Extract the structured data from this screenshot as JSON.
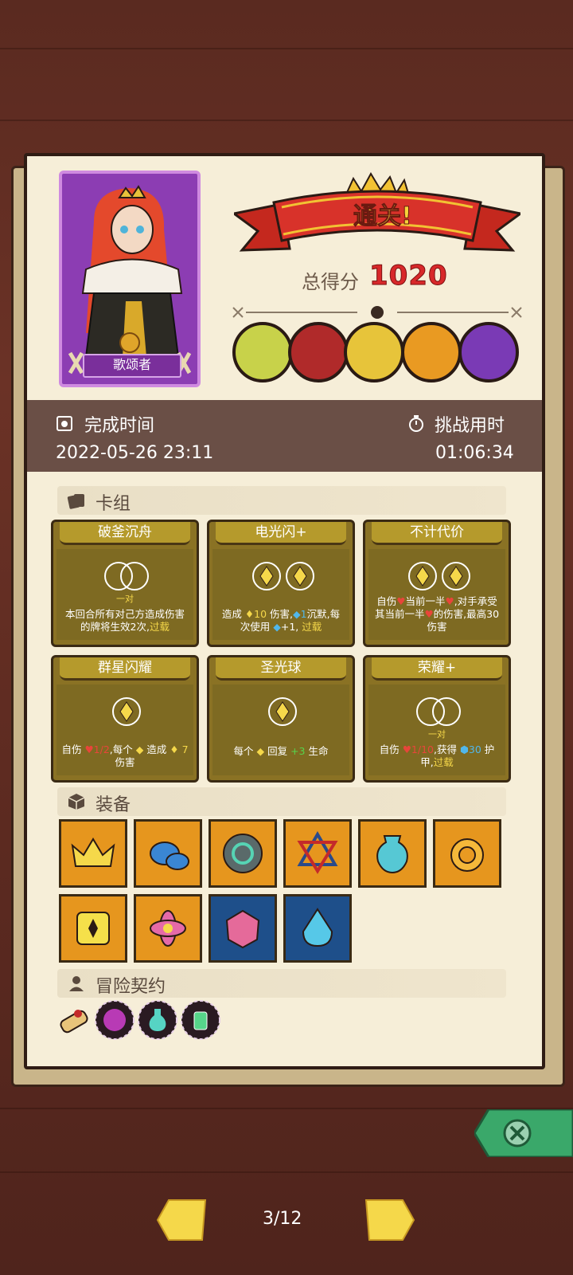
{
  "hero": {
    "name": "歌颂者"
  },
  "result": {
    "banner": "通关!",
    "score_label": "总得分",
    "score_value": "1020"
  },
  "bosses": [
    "bone-dragon-boss",
    "caged-demon-boss",
    "skull-masked-boss",
    "pumpkin-sun-boss",
    "shadow-horned-boss"
  ],
  "time": {
    "complete_label": "完成时间",
    "complete_value": "2022-05-26 23:11",
    "challenge_label": "挑战用时",
    "challenge_value": "01:06:34"
  },
  "sections": {
    "deck": "卡组",
    "equipment": "装备",
    "contract": "冒险契约"
  },
  "cards": [
    {
      "title": "破釜沉舟",
      "sub": "一对",
      "desc_a": "本回合所有对己方造成伤害的牌将生效2次,",
      "desc_kw": "过载"
    },
    {
      "title": "电光闪+",
      "desc_a": "造成",
      "desc_n": "10",
      "desc_b": "伤害,",
      "desc_n2": "1",
      "desc_c": "沉默,每次使用",
      "desc_n3": "+1,",
      "desc_kw": "过载"
    },
    {
      "title": "不计代价",
      "desc_a": "自伤",
      "desc_b": "当前一半",
      "desc_c": ",对手承受其当前一半",
      "desc_d": "的伤害,最高30伤害"
    },
    {
      "title": "群星闪耀",
      "desc_a": "自伤",
      "desc_n": "1/2",
      "desc_b": ",每个",
      "desc_c": "造成",
      "desc_n2": "7",
      "desc_d": "伤害"
    },
    {
      "title": "圣光球",
      "desc_a": "每个",
      "desc_b": "回复",
      "desc_n": "+3",
      "desc_c": "生命"
    },
    {
      "title": "荣耀+",
      "sub": "一对",
      "desc_a": "自伤",
      "desc_n": "1/10",
      "desc_b": ",获得",
      "desc_n2": "30",
      "desc_c": "护甲,",
      "desc_kw": "过载"
    }
  ],
  "equipment": [
    {
      "icon": "crown-icon",
      "bg": "orange"
    },
    {
      "icon": "blue-slime-icon",
      "bg": "orange"
    },
    {
      "icon": "rune-stone-icon",
      "bg": "orange"
    },
    {
      "icon": "hexagram-icon",
      "bg": "orange"
    },
    {
      "icon": "vase-icon",
      "bg": "orange"
    },
    {
      "icon": "lion-ring-icon",
      "bg": "orange"
    },
    {
      "icon": "yellow-dice-icon",
      "bg": "orange"
    },
    {
      "icon": "lotus-icon",
      "bg": "orange"
    },
    {
      "icon": "pink-gem-icon",
      "bg": "blue"
    },
    {
      "icon": "blue-crystal-icon",
      "bg": "blue"
    }
  ],
  "contracts": [
    "scroll-icon",
    "purple-orb-icon",
    "teal-potion-icon",
    "green-bottle-icon"
  ],
  "pager": {
    "page": "3/12"
  },
  "colors": {
    "accent": "#d8282a",
    "band": "#6a4f46",
    "card": "#8a7224",
    "equip_orange": "#e6961e",
    "equip_blue": "#1e4f8a"
  }
}
